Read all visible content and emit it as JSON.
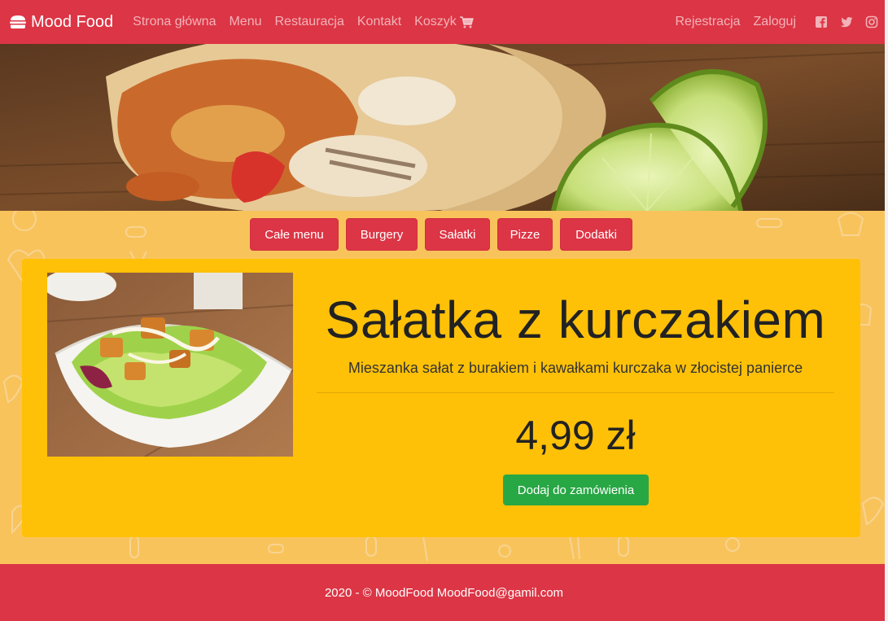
{
  "navbar": {
    "brand": "Mood Food",
    "links": [
      "Strona główna",
      "Menu",
      "Restauracja",
      "Kontakt",
      "Koszyk"
    ],
    "right_links": [
      "Rejestracja",
      "Zaloguj"
    ],
    "social_icons": [
      "facebook-icon",
      "twitter-icon",
      "instagram-icon"
    ]
  },
  "hero": {
    "image": "burrito-with-lime-photo"
  },
  "categories": [
    "Całe menu",
    "Burgery",
    "Sałatki",
    "Pizze",
    "Dodatki"
  ],
  "product": {
    "image": "chicken-salad-photo",
    "title": "Sałatka z kurczakiem",
    "description": "Mieszanka sałat z burakiem i kawałkami kurczaka w złocistej panierce",
    "price": "4,99 zł",
    "add_button": "Dodaj do zamówienia"
  },
  "footer": {
    "text": "2020 - © MoodFood MoodFood@gamil.com"
  },
  "colors": {
    "primary": "#dc3545",
    "card": "#ffc107",
    "background": "#f9c35c",
    "success": "#28a745"
  }
}
